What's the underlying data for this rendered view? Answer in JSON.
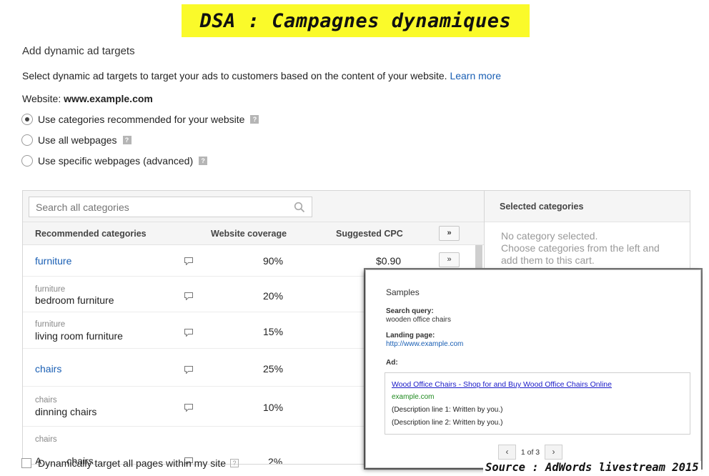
{
  "banner": {
    "title": "DSA : Campagnes dynamiques"
  },
  "page_title": "Add dynamic ad targets",
  "intro": {
    "text": "Select dynamic ad targets to target your ads to customers based on the content of your website.",
    "link": "Learn more"
  },
  "website": {
    "label": "Website:",
    "value": "www.example.com"
  },
  "options": [
    {
      "label": "Use categories recommended for your website",
      "checked": true
    },
    {
      "label": "Use all webpages",
      "checked": false
    },
    {
      "label": "Use specific webpages (advanced)",
      "checked": false
    }
  ],
  "help_glyph": "?",
  "search": {
    "placeholder": "Search all categories"
  },
  "columns": {
    "recommended": "Recommended categories",
    "coverage": "Website coverage",
    "cpc": "Suggested CPC",
    "add_all": "»"
  },
  "rows": [
    {
      "parent": "",
      "name": "furniture",
      "coverage": "90%",
      "cpc": "$0.90",
      "add": "»"
    },
    {
      "parent": "furniture",
      "name": "bedroom furniture",
      "coverage": "20%",
      "cpc": "",
      "add": ""
    },
    {
      "parent": "furniture",
      "name": "living room furniture",
      "coverage": "15%",
      "cpc": "",
      "add": ""
    },
    {
      "parent": "",
      "name": "chairs",
      "coverage": "25%",
      "cpc": "",
      "add": ""
    },
    {
      "parent": "chairs",
      "name": "dinning chairs",
      "coverage": "10%",
      "cpc": "",
      "add": ""
    },
    {
      "parent": "chairs",
      "name": "A____ chairs",
      "coverage": "2%",
      "cpc": "",
      "add": ""
    }
  ],
  "selected": {
    "title": "Selected categories",
    "empty_line1": "No category selected.",
    "empty_line2": "Choose categories from the left and",
    "empty_line3": "add them to this cart."
  },
  "bottom_checkbox": {
    "label": "Dynamically target all pages within my site",
    "checked": false
  },
  "samples": {
    "title": "Samples",
    "query_label": "Search query:",
    "query_value": "wooden office chairs",
    "landing_label": "Landing page:",
    "landing_value": "http://www.example.com",
    "ad_label": "Ad:",
    "ad_headline": "Wood Office Chairs - Shop for and Buy Wood Office Chairs Online",
    "ad_display_url": "example.com",
    "ad_desc1": "(Description line 1: Written by you.)",
    "ad_desc2": "(Description line 2: Written by you.)",
    "pager": {
      "prev": "‹",
      "next": "›",
      "count": "1 of 3"
    }
  },
  "source": "Source : AdWords livestream 2015",
  "colors": {
    "link": "#1a5fb4",
    "banner": "#fafa2a",
    "ad_headline": "#1a1ac8",
    "ad_url": "#1f8a1f"
  }
}
